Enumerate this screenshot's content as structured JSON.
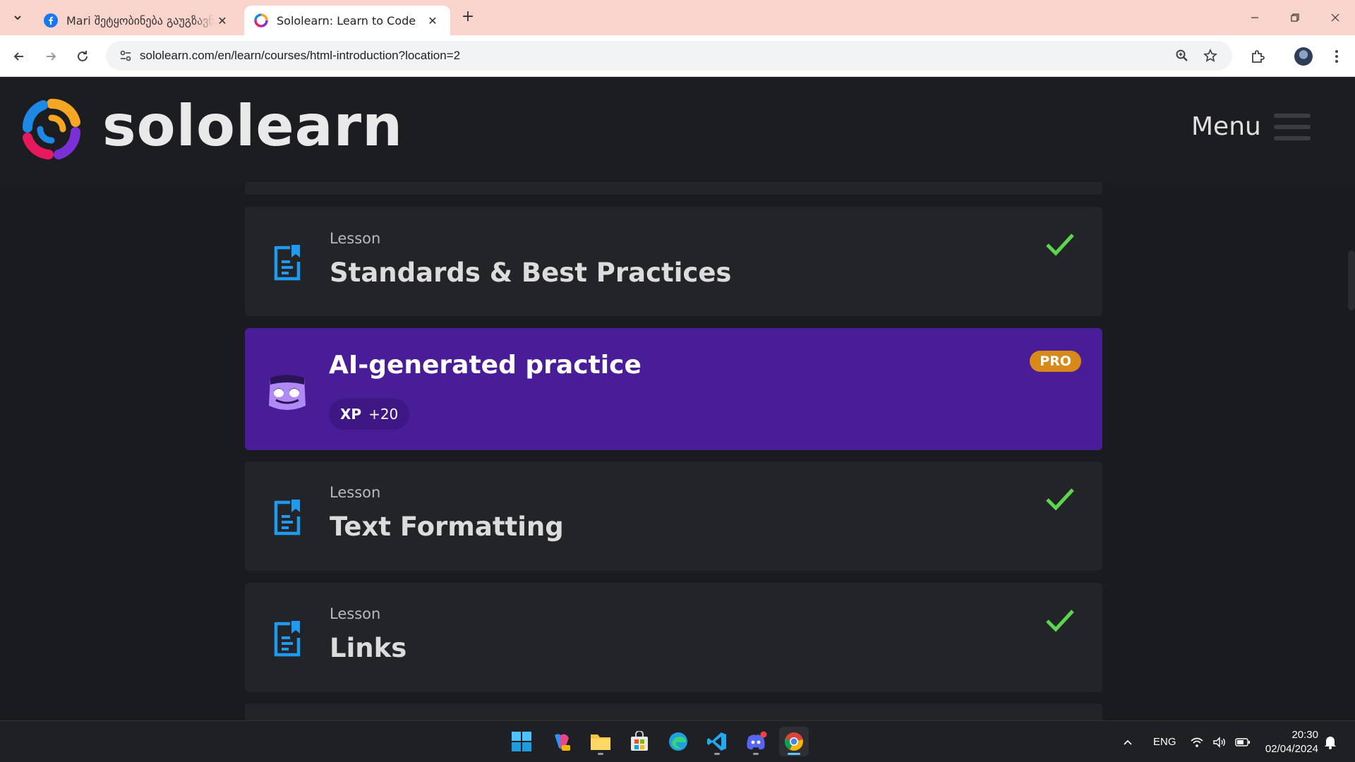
{
  "browser": {
    "tabs": [
      {
        "title": "Mari შეტყობინება გაუგზავნ",
        "active": false
      },
      {
        "title": "Sololearn: Learn to Code",
        "active": true
      }
    ],
    "url": "sololearn.com/en/learn/courses/html-introduction?location=2"
  },
  "header": {
    "logo_text": "sololearn",
    "menu_label": "Menu"
  },
  "cards": [
    {
      "kind": "Lesson",
      "title": "Standards & Best Practices",
      "completed": true
    },
    {
      "kind": "Lesson",
      "title": "Text Formatting",
      "completed": true
    },
    {
      "kind": "Lesson",
      "title": "Links",
      "completed": true
    }
  ],
  "ai_practice": {
    "title": "AI-generated practice",
    "xp_label": "XP",
    "xp_value": "+20",
    "badge": "PRO"
  },
  "taskbar": {
    "language": "ENG",
    "time": "20:30",
    "date": "02/04/2024"
  },
  "colors": {
    "background": "#1a1b1e",
    "card": "#232428",
    "ai_card": "#491d97",
    "pro_badge": "#d7891a",
    "check": "#5bd64e",
    "lesson_icon": "#1e9bf0"
  }
}
